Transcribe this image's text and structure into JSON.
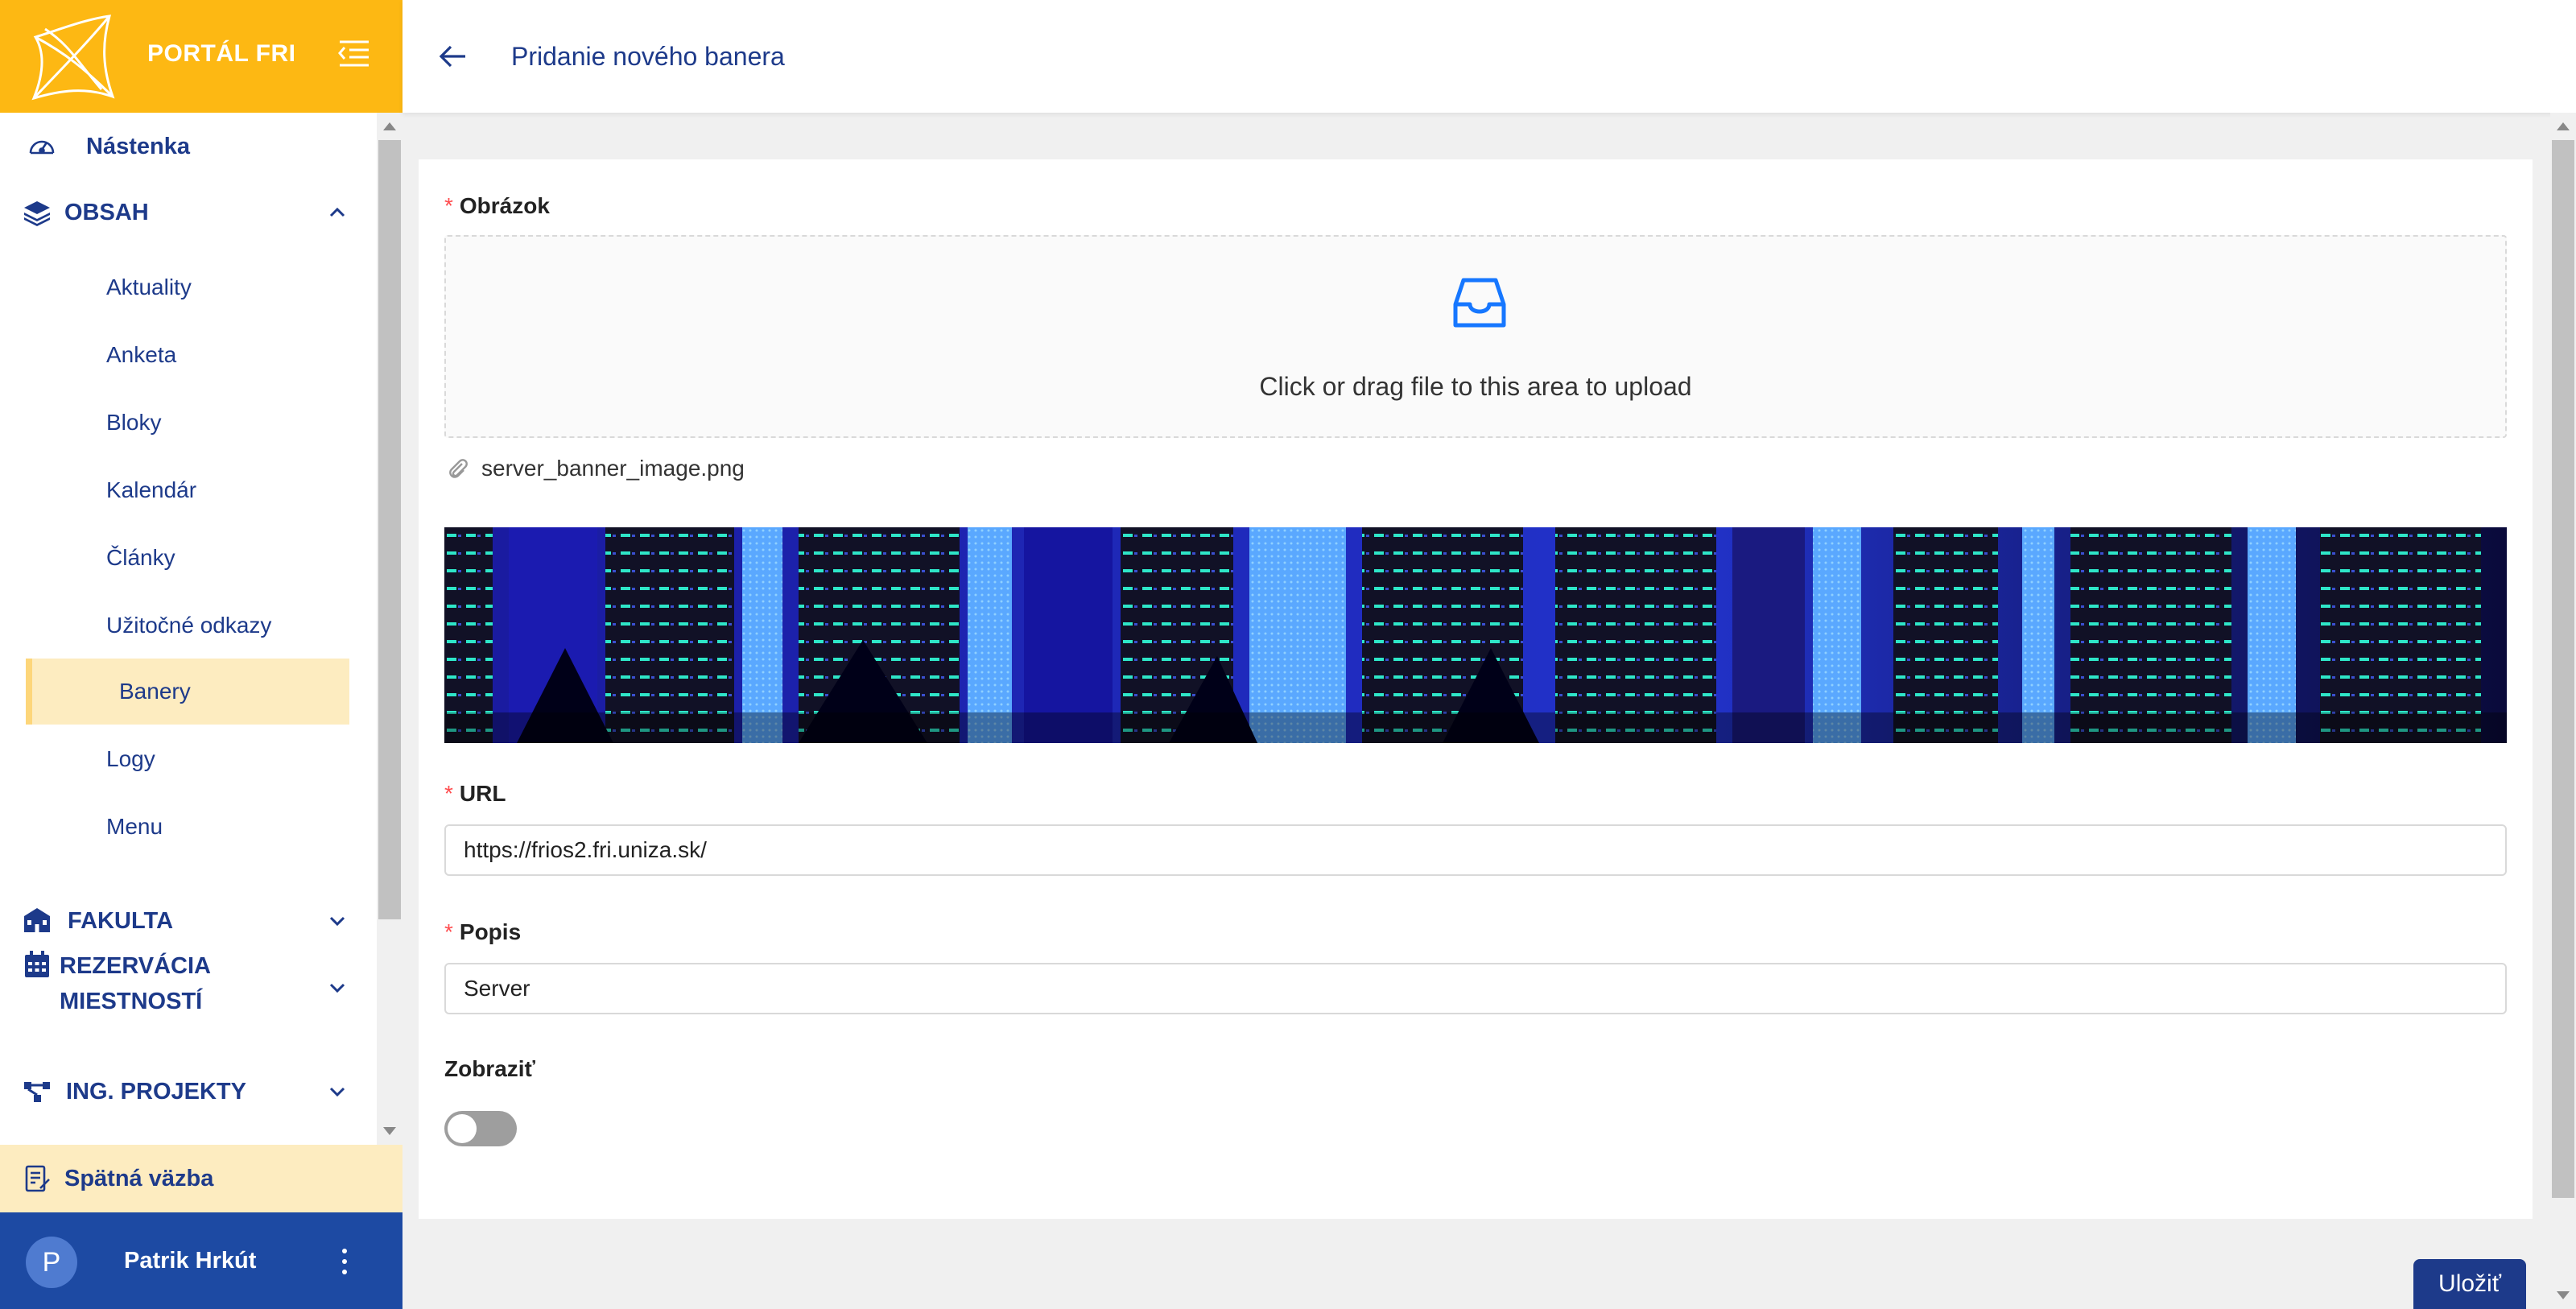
{
  "brand": {
    "title": "PORTÁL FRI",
    "logo_icon": "fri-star-logo",
    "menu_icon": "menu-fold-icon",
    "color": "#fdb813"
  },
  "sidebar": {
    "dashboard": {
      "label": "Nástenka",
      "icon": "dashboard-icon"
    },
    "content": {
      "label": "OBSAH",
      "icon": "layers-icon",
      "expanded": true,
      "items": [
        {
          "label": "Aktuality",
          "active": false
        },
        {
          "label": "Anketa",
          "active": false
        },
        {
          "label": "Bloky",
          "active": false
        },
        {
          "label": "Kalendár",
          "active": false
        },
        {
          "label": "Články",
          "active": false
        },
        {
          "label": "Užitočné odkazy",
          "active": false
        },
        {
          "label": "Banery",
          "active": true
        },
        {
          "label": "Logy",
          "active": false
        },
        {
          "label": "Menu",
          "active": false
        }
      ]
    },
    "faculty": {
      "label": "FAKULTA",
      "icon": "building-icon"
    },
    "reservations": {
      "label_line1": "REZERVÁCIA",
      "label_line2": "MIESTNOSTÍ",
      "icon": "calendar-icon"
    },
    "projects": {
      "label": "ING. PROJEKTY",
      "icon": "network-icon"
    },
    "feedback": {
      "label": "Spätná väzba",
      "icon": "feedback-icon"
    },
    "user": {
      "initial": "P",
      "name": "Patrik Hrkút"
    }
  },
  "header": {
    "title": "Pridanie nového banera"
  },
  "form": {
    "image": {
      "label": "Obrázok",
      "upload_hint": "Click or drag file to this area to upload",
      "file_name": "server_banner_image.png"
    },
    "url": {
      "label": "URL",
      "value": "https://frios2.fri.uniza.sk/"
    },
    "description": {
      "label": "Popis",
      "value": "Server"
    },
    "show": {
      "label": "Zobraziť",
      "enabled": false
    },
    "required_mark": "*",
    "save_label": "Uložiť"
  },
  "colors": {
    "primary": "#1d3a8a",
    "accent": "#fdb813",
    "active_bg": "#fdecc0",
    "upload_icon": "#1677ff",
    "required": "#ff4d4f"
  }
}
